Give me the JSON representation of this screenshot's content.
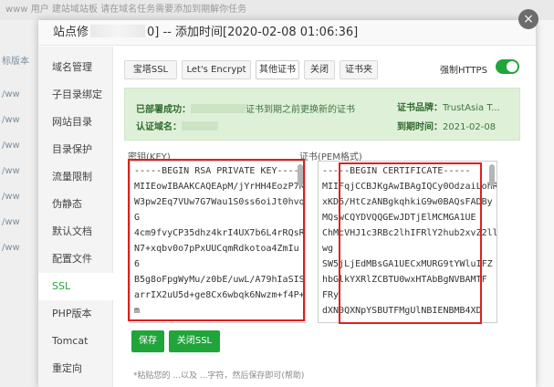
{
  "background": {
    "top_text": "www 用户   建站域站板   请在域名任务需要添加到期解你任务",
    "left_items": [
      "标版本",
      "/ww",
      "/ww",
      "/ww",
      "/ww",
      "/ww",
      "/ww",
      "/ww"
    ]
  },
  "dialog": {
    "title_prefix": "站点修",
    "title_suffix": "0] -- 添加时间[2020-02-08 01:06:36]",
    "close_symbol": "×"
  },
  "sidebar": {
    "items": [
      {
        "label": "域名管理",
        "active": false
      },
      {
        "label": "子目录绑定",
        "active": false
      },
      {
        "label": "网站目录",
        "active": false
      },
      {
        "label": "目录保护",
        "active": false
      },
      {
        "label": "流量限制",
        "active": false
      },
      {
        "label": "伪静态",
        "active": false
      },
      {
        "label": "默认文档",
        "active": false
      },
      {
        "label": "配置文件",
        "active": false
      },
      {
        "label": "SSL",
        "active": true
      },
      {
        "label": "PHP版本",
        "active": false
      },
      {
        "label": "Tomcat",
        "active": false
      },
      {
        "label": "重定向",
        "active": false
      }
    ]
  },
  "tabs": [
    {
      "label": "宝塔SSL",
      "active": false
    },
    {
      "label": "Let's Encrypt",
      "active": false
    },
    {
      "label": "其他证书",
      "active": true
    },
    {
      "label": "关闭",
      "active": false
    },
    {
      "label": "证书夹",
      "active": false
    }
  ],
  "https_toggle": {
    "label": "强制HTTPS",
    "on": true
  },
  "info": {
    "status_label": "已部署成功：",
    "status_text": "证书到期之前更换新的证书",
    "domain_label": "认证域名：",
    "brand_label": "证书品牌：",
    "brand_value": "TrustAsia T...",
    "expiry_label": "到期时间：",
    "expiry_value": "2021-02-08"
  },
  "key_box": {
    "label": "密钥(KEY)",
    "lines": [
      "-----BEGIN RSA PRIVATE KEY-----",
      "MIIEowIBAAKCAQEApM/jYrHH4EozP7Kl",
      "W3pw2Eq7VUw7G7Wau1S0ss6oiJt0hvq",
      "G",
      "4cm9fvyCP35dhz4krI4UX7b6L4rRQsRGS",
      "N7+xqbv0o7pPxUUCqmRdkotoa4ZmIu",
      "6",
      "B5g8oFpgWyMu/z0bE/uwL/A79hIaSIS3",
      "arrIX2uU5d+ge8Cx6wbqk6Nwzm+f4P+",
      "m"
    ]
  },
  "cert_box": {
    "label": "证书(PEM格式)",
    "lines": [
      "-----BEGIN CERTIFICATE-----",
      "MIIFqjCCBJKgAwIBAgIQCy0OdzaiLohRK",
      "xKD6/HtCzANBgkqhkiG9w0BAQsFADBy",
      "MQswCQYDVQQGEwJDTjElMCMGA1UE",
      "ChMcVHJ1c3RBc2lhIFRlY2hub2xvZ2llcy",
      "wg",
      "SW5jLjEdMBsGA1UECxMURG9tYWluIFZ",
      "hbGlkYXRlZCBTU0wxHTAbBgNVBAMTF",
      "FRy",
      "dXN0QXNpYSBUTFMgUlNBIENBMB4XD"
    ]
  },
  "buttons": {
    "save": "保存",
    "close_ssl": "关闭SSL"
  },
  "footer_note": "*粘贴您的 ...以及 ...字符，然后保存即可(帮助)"
}
